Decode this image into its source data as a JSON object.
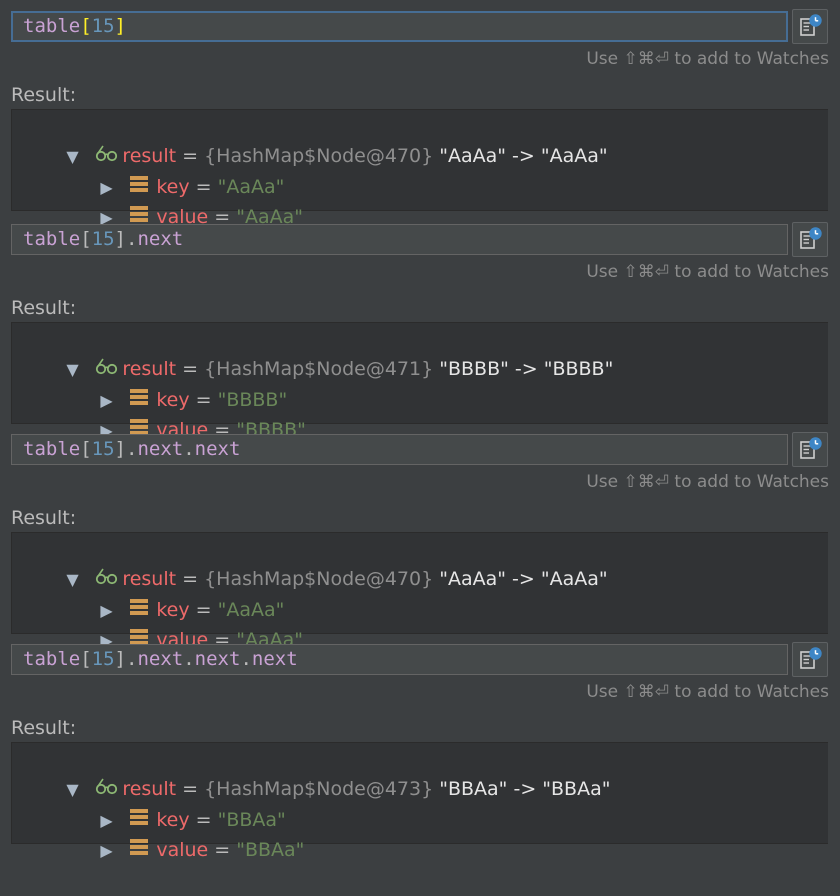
{
  "blocks": [
    {
      "focused": true,
      "expr_tokens": [
        {
          "text": "table",
          "cls": "tok-id"
        },
        {
          "text": "[",
          "cls": "tok-brh"
        },
        {
          "text": "15",
          "cls": "tok-num"
        },
        {
          "text": "]",
          "cls": "tok-brh"
        }
      ],
      "hint": "Use ⇧⌘⏎ to add to Watches",
      "result_label": "Result:",
      "result": {
        "name": "result",
        "ref": "{HashMap$Node@470}",
        "summary": "\"AaAa\" -> \"AaAa\""
      },
      "fields": [
        {
          "name": "key",
          "value": "\"AaAa\""
        },
        {
          "name": "value",
          "value": "\"AaAa\""
        }
      ]
    },
    {
      "focused": false,
      "expr_tokens": [
        {
          "text": "table",
          "cls": "tok-id"
        },
        {
          "text": "[",
          "cls": "tok-br"
        },
        {
          "text": "15",
          "cls": "tok-num"
        },
        {
          "text": "]",
          "cls": "tok-br"
        },
        {
          "text": ".",
          "cls": "tok-br"
        },
        {
          "text": "next",
          "cls": "tok-id"
        }
      ],
      "hint": "Use ⇧⌘⏎ to add to Watches",
      "result_label": "Result:",
      "result": {
        "name": "result",
        "ref": "{HashMap$Node@471}",
        "summary": "\"BBBB\" -> \"BBBB\""
      },
      "fields": [
        {
          "name": "key",
          "value": "\"BBBB\""
        },
        {
          "name": "value",
          "value": "\"BBBB\""
        }
      ]
    },
    {
      "focused": false,
      "expr_tokens": [
        {
          "text": "table",
          "cls": "tok-id"
        },
        {
          "text": "[",
          "cls": "tok-br"
        },
        {
          "text": "15",
          "cls": "tok-num"
        },
        {
          "text": "]",
          "cls": "tok-br"
        },
        {
          "text": ".",
          "cls": "tok-br"
        },
        {
          "text": "next",
          "cls": "tok-id"
        },
        {
          "text": ".",
          "cls": "tok-br"
        },
        {
          "text": "next",
          "cls": "tok-id"
        }
      ],
      "hint": "Use ⇧⌘⏎ to add to Watches",
      "result_label": "Result:",
      "result": {
        "name": "result",
        "ref": "{HashMap$Node@470}",
        "summary": "\"AaAa\" -> \"AaAa\""
      },
      "fields": [
        {
          "name": "key",
          "value": "\"AaAa\""
        },
        {
          "name": "value",
          "value": "\"AaAa\""
        }
      ]
    },
    {
      "focused": false,
      "expr_tokens": [
        {
          "text": "table",
          "cls": "tok-id"
        },
        {
          "text": "[",
          "cls": "tok-br"
        },
        {
          "text": "15",
          "cls": "tok-num"
        },
        {
          "text": "]",
          "cls": "tok-br"
        },
        {
          "text": ".",
          "cls": "tok-br"
        },
        {
          "text": "next",
          "cls": "tok-id"
        },
        {
          "text": ".",
          "cls": "tok-br"
        },
        {
          "text": "next",
          "cls": "tok-id"
        },
        {
          "text": ".",
          "cls": "tok-br"
        },
        {
          "text": "next",
          "cls": "tok-id"
        }
      ],
      "hint": "Use ⇧⌘⏎ to add to Watches",
      "result_label": "Result:",
      "result": {
        "name": "result",
        "ref": "{HashMap$Node@473}",
        "summary": "\"BBAa\" -> \"BBAa\""
      },
      "fields": [
        {
          "name": "key",
          "value": "\"BBAa\""
        },
        {
          "name": "value",
          "value": "\"BBAa\""
        }
      ]
    }
  ],
  "icons": {
    "expand": "triangle-down-icon",
    "collapse": "triangle-right-icon",
    "watch": "add-to-watches-icon",
    "result": "glasses-icon",
    "field": "field-icon"
  },
  "colors": {
    "background": "#3c3f41",
    "name": "#ee6a6a",
    "string_value": "#6a8759",
    "number": "#6897bb"
  }
}
